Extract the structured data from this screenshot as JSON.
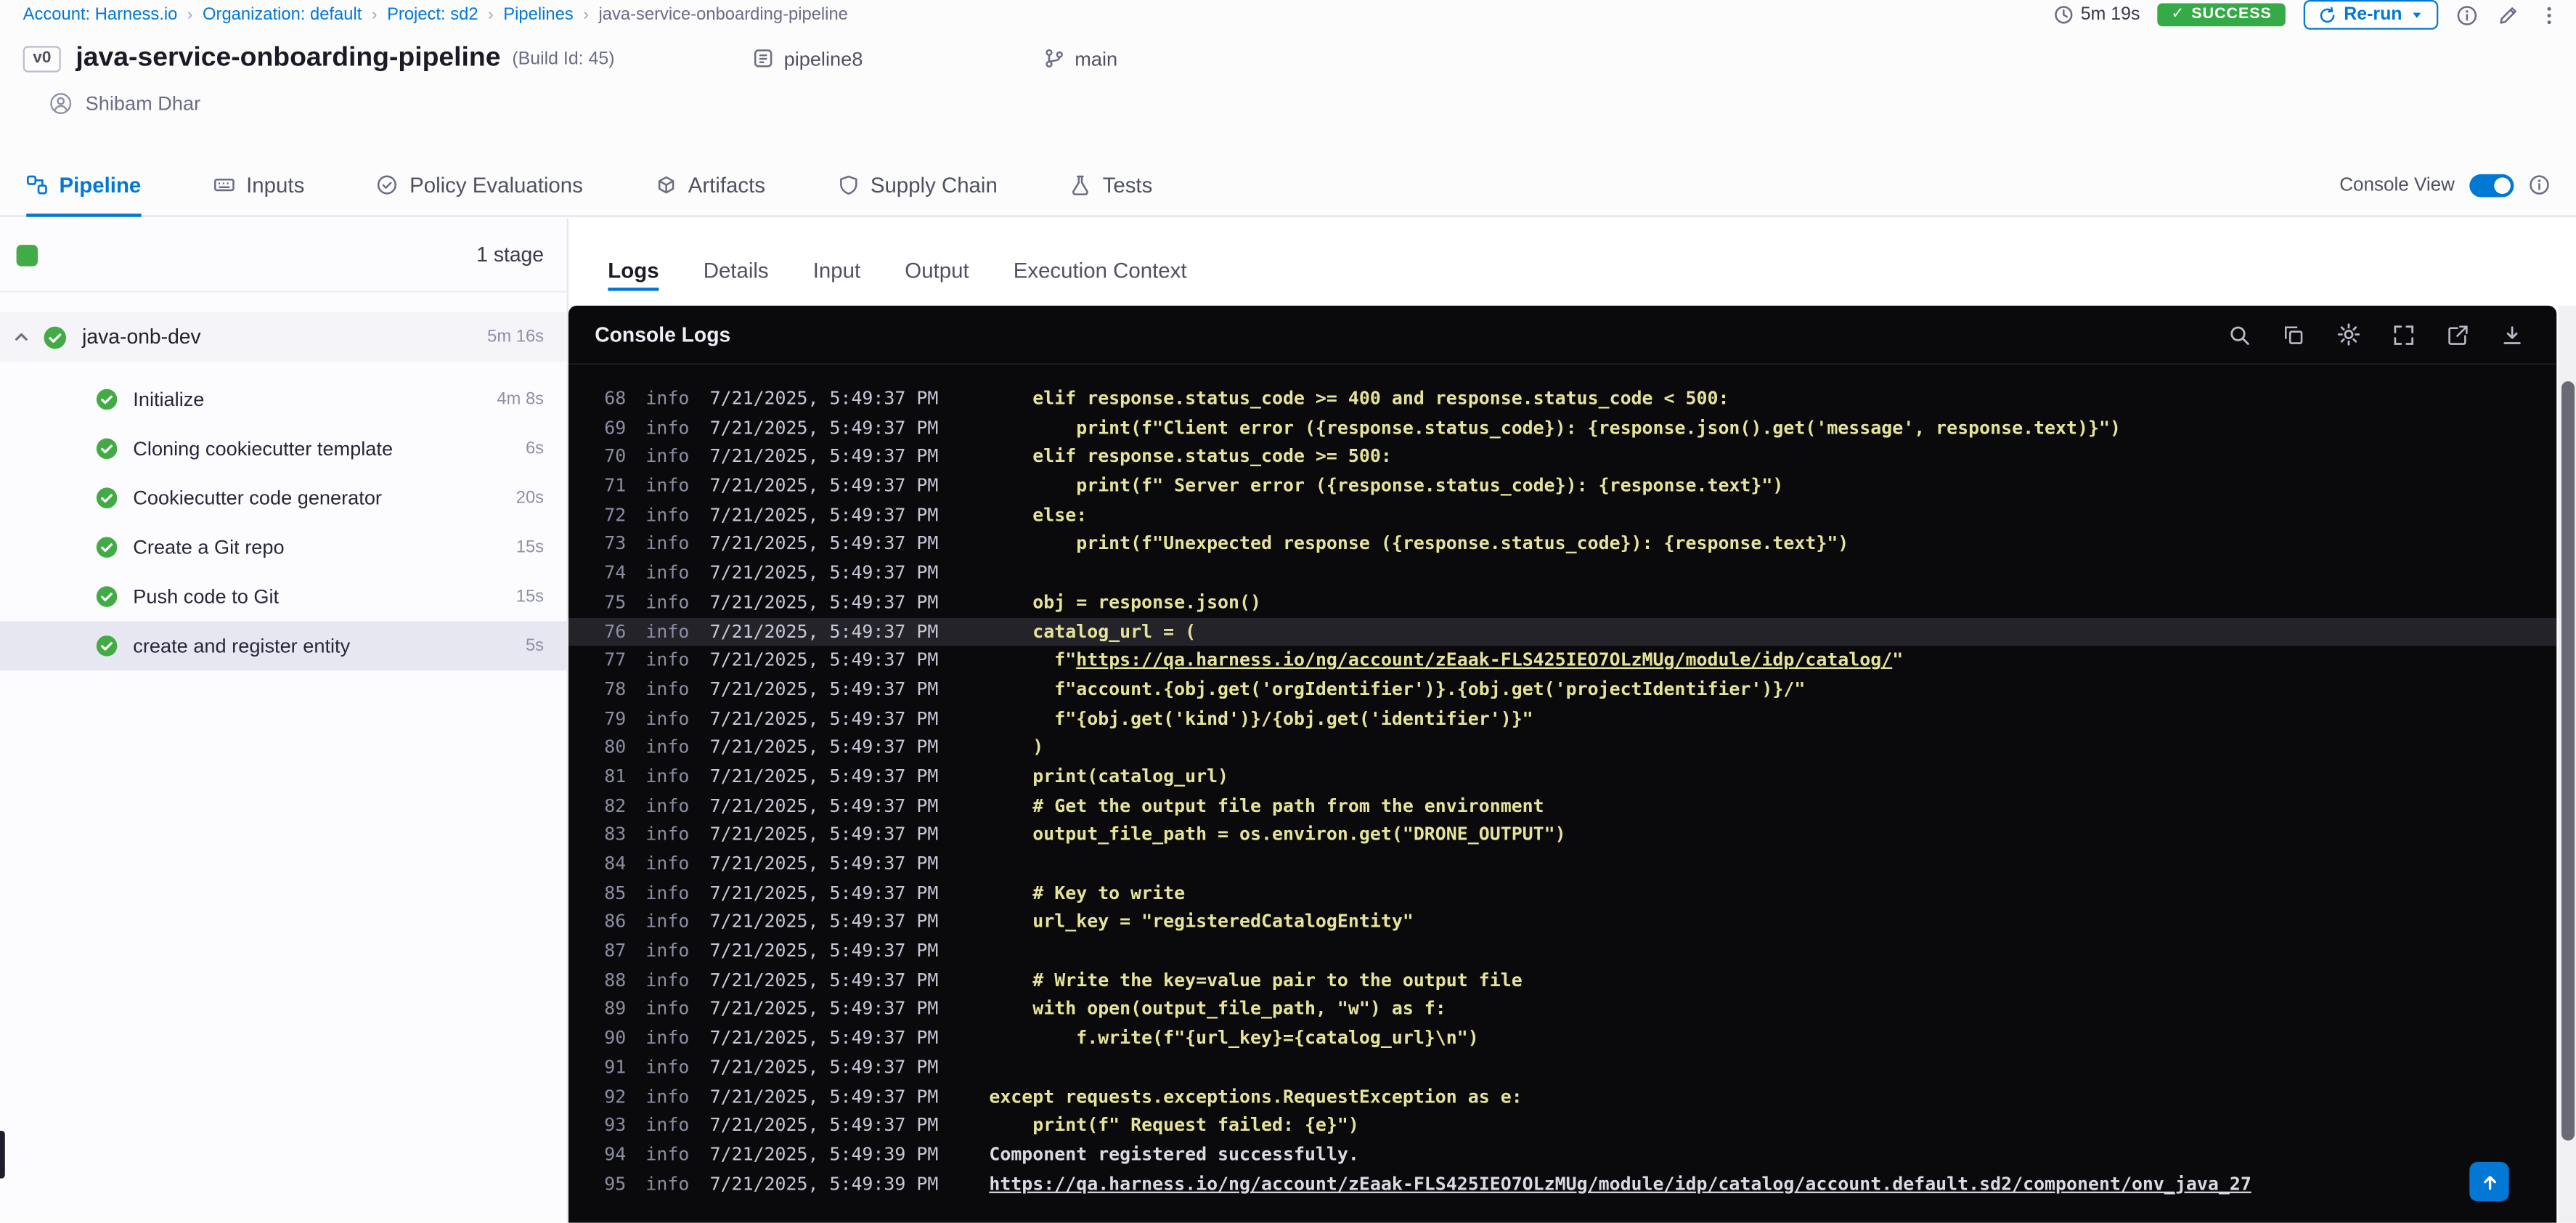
{
  "breadcrumb": {
    "items": [
      {
        "label": "Account: Harness.io"
      },
      {
        "label": "Organization: default"
      },
      {
        "label": "Project: sd2"
      },
      {
        "label": "Pipelines"
      },
      {
        "label": "java-service-onboarding-pipeline"
      }
    ],
    "duration": "5m 19s",
    "status": "SUCCESS",
    "rerun_label": "Re-run",
    "action_icons": [
      "info-icon",
      "edit-icon",
      "more-icon"
    ]
  },
  "header": {
    "version_badge": "v0",
    "title": "java-service-onboarding-pipeline",
    "build_id": "(Build Id: 45)",
    "pipeline_name": "pipeline8",
    "branch": "main",
    "user": "Shibam Dhar"
  },
  "tabs": {
    "items": [
      {
        "label": "Pipeline",
        "icon": "pipeline-icon",
        "active": true
      },
      {
        "label": "Inputs",
        "icon": "inputs-icon"
      },
      {
        "label": "Policy Evaluations",
        "icon": "policy-icon"
      },
      {
        "label": "Artifacts",
        "icon": "artifacts-icon"
      },
      {
        "label": "Supply Chain",
        "icon": "supply-chain-icon"
      },
      {
        "label": "Tests",
        "icon": "tests-icon"
      }
    ],
    "console_view_label": "Console View",
    "console_view_enabled": true
  },
  "sidebar": {
    "stage_count": "1 stage",
    "stage": {
      "name": "java-onb-dev",
      "duration": "5m 16s"
    },
    "steps": [
      {
        "label": "Initialize",
        "duration": "4m 8s"
      },
      {
        "label": "Cloning cookiecutter template",
        "duration": "6s"
      },
      {
        "label": "Cookiecutter code generator",
        "duration": "20s"
      },
      {
        "label": "Create a Git repo",
        "duration": "15s"
      },
      {
        "label": "Push code to Git",
        "duration": "15s"
      },
      {
        "label": "create and register entity",
        "duration": "5s",
        "selected": true
      }
    ]
  },
  "main": {
    "tabs": [
      {
        "label": "Logs",
        "active": true
      },
      {
        "label": "Details"
      },
      {
        "label": "Input"
      },
      {
        "label": "Output"
      },
      {
        "label": "Execution Context"
      }
    ],
    "console_title": "Console Logs",
    "console_icons": [
      "search-icon",
      "copy-icon",
      "settings-icon",
      "fullscreen-icon",
      "open-in-new-icon",
      "download-icon"
    ]
  },
  "logs": {
    "lines": [
      {
        "n": 68,
        "level": "info",
        "ts": "7/21/2025, 5:49:37 PM",
        "seg": [
          {
            "t": "    elif response.status_code >= 400 and response.status_code < 500:"
          }
        ]
      },
      {
        "n": 69,
        "level": "info",
        "ts": "7/21/2025, 5:49:37 PM",
        "seg": [
          {
            "t": "        print(f\"Client error ({response.status_code}): {response.json().get('message', response.text)}\")"
          }
        ]
      },
      {
        "n": 70,
        "level": "info",
        "ts": "7/21/2025, 5:49:37 PM",
        "seg": [
          {
            "t": "    elif response.status_code >= 500:"
          }
        ]
      },
      {
        "n": 71,
        "level": "info",
        "ts": "7/21/2025, 5:49:37 PM",
        "seg": [
          {
            "t": "        print(f\" Server error ({response.status_code}): {response.text}\")"
          }
        ]
      },
      {
        "n": 72,
        "level": "info",
        "ts": "7/21/2025, 5:49:37 PM",
        "seg": [
          {
            "t": "    else:"
          }
        ]
      },
      {
        "n": 73,
        "level": "info",
        "ts": "7/21/2025, 5:49:37 PM",
        "seg": [
          {
            "t": "        print(f\"Unexpected response ({response.status_code}): {response.text}\")"
          }
        ]
      },
      {
        "n": 74,
        "level": "info",
        "ts": "7/21/2025, 5:49:37 PM",
        "seg": [
          {
            "t": ""
          }
        ]
      },
      {
        "n": 75,
        "level": "info",
        "ts": "7/21/2025, 5:49:37 PM",
        "seg": [
          {
            "t": "    obj = response.json()"
          }
        ]
      },
      {
        "n": 76,
        "level": "info",
        "ts": "7/21/2025, 5:49:37 PM",
        "hl": true,
        "seg": [
          {
            "t": "    catalog_url = ("
          }
        ]
      },
      {
        "n": 77,
        "level": "info",
        "ts": "7/21/2025, 5:49:37 PM",
        "seg": [
          {
            "t": "      f\""
          },
          {
            "t": "https://qa.harness.io/ng/account/zEaak-FLS425IEO7OLzMUg/module/idp/catalog/",
            "u": true
          },
          {
            "t": "\""
          }
        ]
      },
      {
        "n": 78,
        "level": "info",
        "ts": "7/21/2025, 5:49:37 PM",
        "seg": [
          {
            "t": "      f\"account.{obj.get('orgIdentifier')}.{obj.get('projectIdentifier')}/\""
          }
        ]
      },
      {
        "n": 79,
        "level": "info",
        "ts": "7/21/2025, 5:49:37 PM",
        "seg": [
          {
            "t": "      f\"{obj.get('kind')}/{obj.get('identifier')}\""
          }
        ]
      },
      {
        "n": 80,
        "level": "info",
        "ts": "7/21/2025, 5:49:37 PM",
        "seg": [
          {
            "t": "    )"
          }
        ]
      },
      {
        "n": 81,
        "level": "info",
        "ts": "7/21/2025, 5:49:37 PM",
        "seg": [
          {
            "t": "    print(catalog_url)"
          }
        ]
      },
      {
        "n": 82,
        "level": "info",
        "ts": "7/21/2025, 5:49:37 PM",
        "seg": [
          {
            "t": "    # Get the output file path from the environment"
          }
        ]
      },
      {
        "n": 83,
        "level": "info",
        "ts": "7/21/2025, 5:49:37 PM",
        "seg": [
          {
            "t": "    output_file_path = os.environ.get(\"DRONE_OUTPUT\")"
          }
        ]
      },
      {
        "n": 84,
        "level": "info",
        "ts": "7/21/2025, 5:49:37 PM",
        "seg": [
          {
            "t": ""
          }
        ]
      },
      {
        "n": 85,
        "level": "info",
        "ts": "7/21/2025, 5:49:37 PM",
        "seg": [
          {
            "t": "    # Key to write"
          }
        ]
      },
      {
        "n": 86,
        "level": "info",
        "ts": "7/21/2025, 5:49:37 PM",
        "seg": [
          {
            "t": "    url_key = \"registeredCatalogEntity\""
          }
        ]
      },
      {
        "n": 87,
        "level": "info",
        "ts": "7/21/2025, 5:49:37 PM",
        "seg": [
          {
            "t": ""
          }
        ]
      },
      {
        "n": 88,
        "level": "info",
        "ts": "7/21/2025, 5:49:37 PM",
        "seg": [
          {
            "t": "    # Write the key=value pair to the output file"
          }
        ]
      },
      {
        "n": 89,
        "level": "info",
        "ts": "7/21/2025, 5:49:37 PM",
        "seg": [
          {
            "t": "    with open(output_file_path, \"w\") as f:"
          }
        ]
      },
      {
        "n": 90,
        "level": "info",
        "ts": "7/21/2025, 5:49:37 PM",
        "seg": [
          {
            "t": "        f.write(f\"{url_key}={catalog_url}\\n\")"
          }
        ]
      },
      {
        "n": 91,
        "level": "info",
        "ts": "7/21/2025, 5:49:37 PM",
        "seg": [
          {
            "t": ""
          }
        ]
      },
      {
        "n": 92,
        "level": "info",
        "ts": "7/21/2025, 5:49:37 PM",
        "seg": [
          {
            "t": "except requests.exceptions.RequestException as e:"
          }
        ]
      },
      {
        "n": 93,
        "level": "info",
        "ts": "7/21/2025, 5:49:37 PM",
        "seg": [
          {
            "t": "    print(f\" Request failed: {e}\")"
          }
        ]
      },
      {
        "n": 94,
        "level": "info",
        "ts": "7/21/2025, 5:49:39 PM",
        "seg": [
          {
            "t": "Component registered successfully.",
            "plain": true
          }
        ]
      },
      {
        "n": 95,
        "level": "info",
        "ts": "7/21/2025, 5:49:39 PM",
        "seg": [
          {
            "t": "https://qa.harness.io/ng/account/zEaak-FLS425IEO7OLzMUg/module/idp/catalog/account.default.sd2/component/onv_java_27",
            "plain": true,
            "u": true
          }
        ]
      }
    ]
  }
}
